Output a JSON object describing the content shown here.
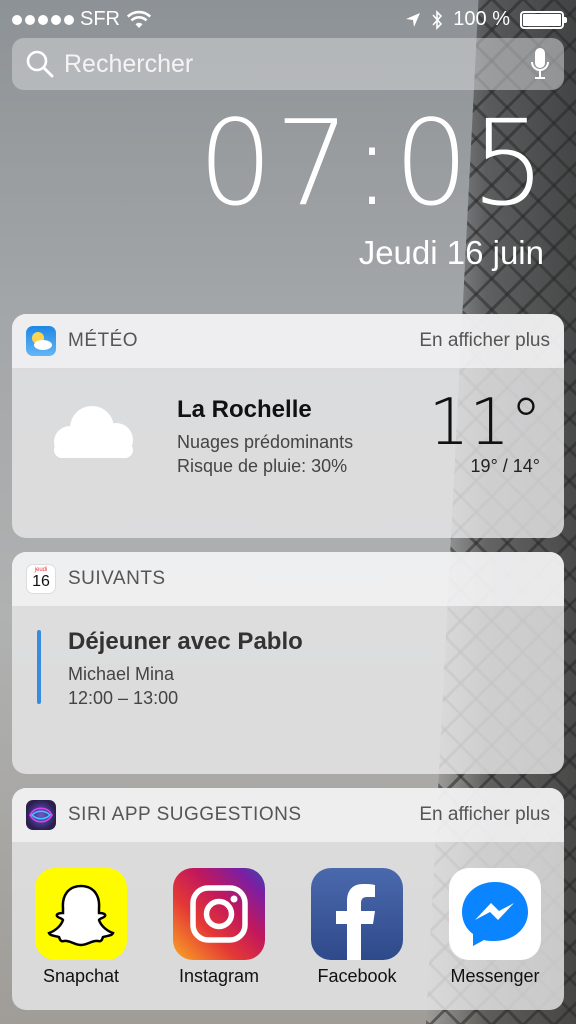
{
  "status_bar": {
    "carrier": "SFR",
    "battery_text": "100 %",
    "battery_level": 1.0
  },
  "search": {
    "placeholder": "Rechercher"
  },
  "lock": {
    "time": "07:05",
    "date": "Jeudi 16 juin"
  },
  "weather_widget": {
    "title": "MÉTÉO",
    "more_label": "En afficher plus",
    "city": "La Rochelle",
    "condition": "Nuages prédominants",
    "rain": "Risque de pluie: 30%",
    "temperature": "11°",
    "high_low": "19° / 14°",
    "icon": "cloud-icon"
  },
  "calendar_widget": {
    "title": "SUIVANTS",
    "icon_day_label": "jeudi",
    "icon_day_number": "16",
    "event_title": "Déjeuner avec Pablo",
    "event_person": "Michael Mina",
    "event_time": "12:00 – 13:00",
    "event_color": "#3a8be0"
  },
  "siri_widget": {
    "title": "SIRI APP SUGGESTIONS",
    "more_label": "En afficher plus",
    "apps": [
      {
        "label": "Snapchat",
        "icon": "snapchat-icon",
        "color": "#fffc00"
      },
      {
        "label": "Instagram",
        "icon": "instagram-icon",
        "color": "#c13584"
      },
      {
        "label": "Facebook",
        "icon": "facebook-icon",
        "color": "#3b5998"
      },
      {
        "label": "Messenger",
        "icon": "messenger-icon",
        "color": "#0084ff"
      }
    ]
  }
}
